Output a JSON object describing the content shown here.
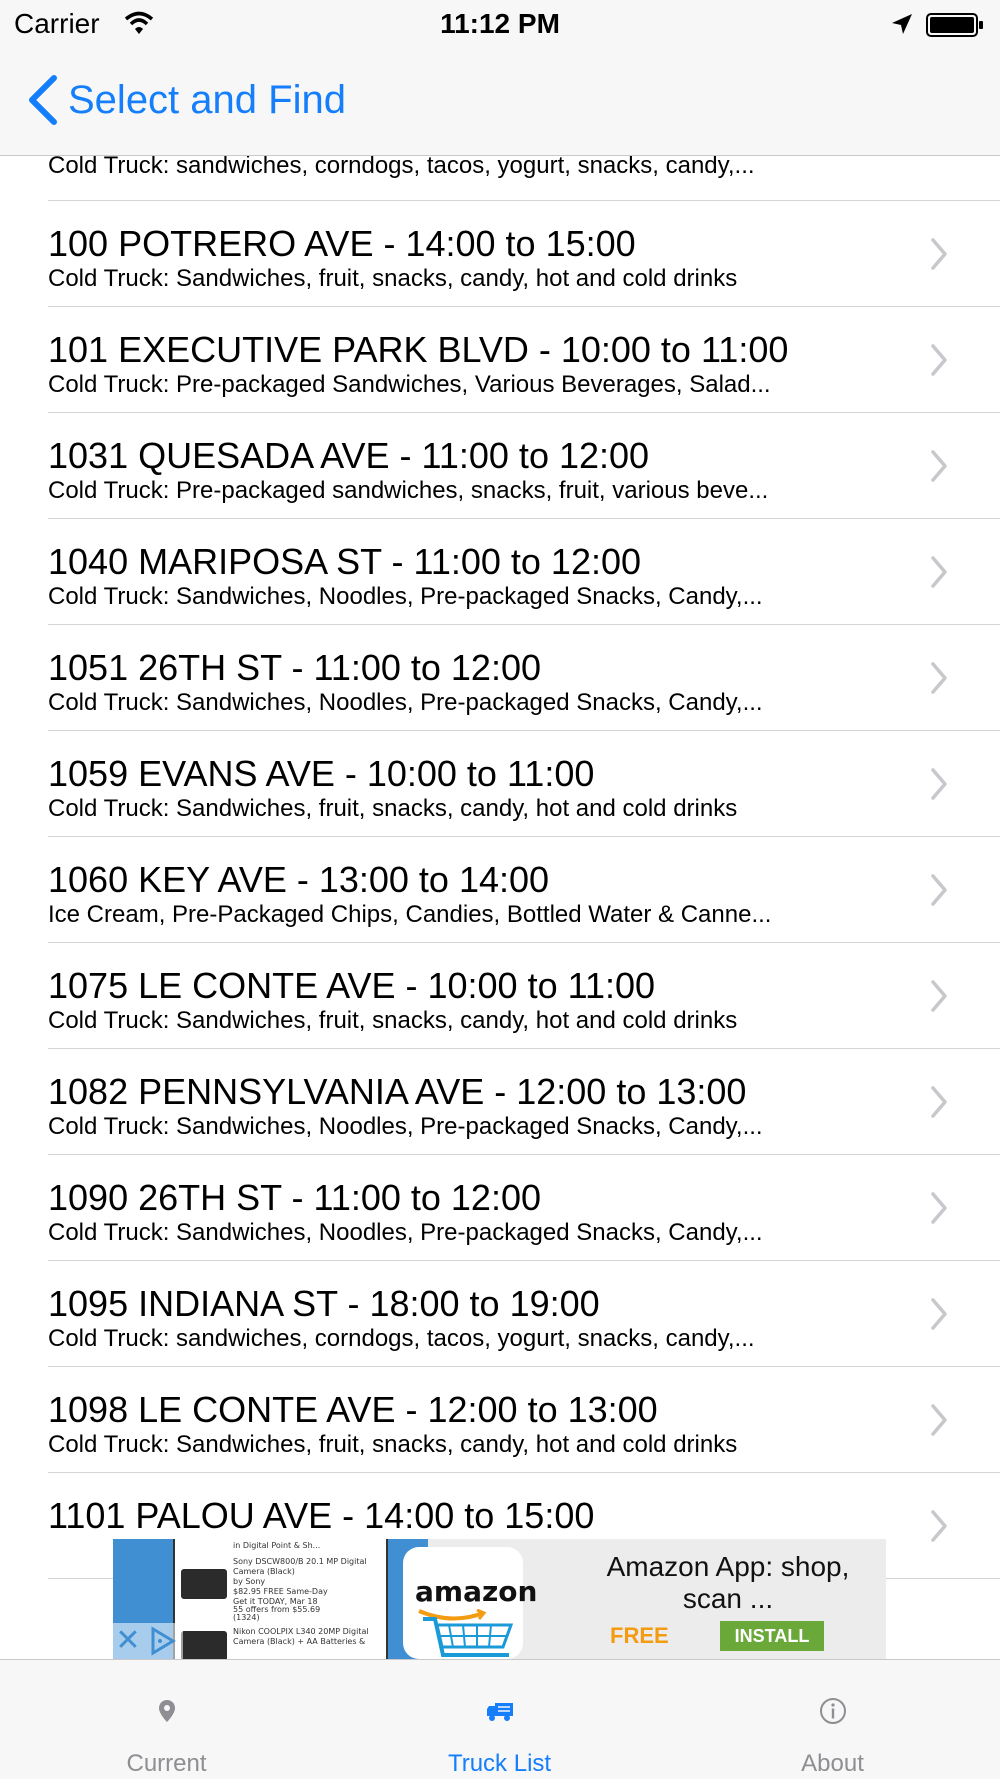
{
  "status_bar": {
    "carrier": "Carrier",
    "time": "11:12 PM",
    "icons": [
      "wifi-icon",
      "location-arrow-icon",
      "battery-icon"
    ]
  },
  "nav": {
    "back_label": "Select and Find",
    "back_icon": "chevron-left-icon"
  },
  "list": {
    "partial_top_subtitle": "Cold Truck: sandwiches, corndogs, tacos, yogurt, snacks, candy,...",
    "items": [
      {
        "title": "100 POTRERO AVE - 14:00 to 15:00",
        "subtitle": "Cold Truck: Sandwiches, fruit, snacks, candy, hot and cold drinks"
      },
      {
        "title": "101 EXECUTIVE PARK BLVD - 10:00 to 11:00",
        "subtitle": "Cold Truck: Pre-packaged Sandwiches, Various Beverages, Salad..."
      },
      {
        "title": "1031 QUESADA AVE - 11:00 to 12:00",
        "subtitle": "Cold Truck: Pre-packaged sandwiches, snacks, fruit, various beve..."
      },
      {
        "title": "1040 MARIPOSA ST - 11:00 to 12:00",
        "subtitle": "Cold Truck: Sandwiches, Noodles,  Pre-packaged Snacks, Candy,..."
      },
      {
        "title": "1051 26TH ST - 11:00 to 12:00",
        "subtitle": "Cold Truck: Sandwiches, Noodles,  Pre-packaged Snacks, Candy,..."
      },
      {
        "title": "1059 EVANS AVE - 10:00 to 11:00",
        "subtitle": "Cold Truck: Sandwiches, fruit, snacks, candy, hot and cold drinks"
      },
      {
        "title": "1060 KEY AVE - 13:00 to 14:00",
        "subtitle": "Ice Cream, Pre-Packaged Chips, Candies, Bottled Water & Canne..."
      },
      {
        "title": "1075 LE CONTE AVE - 10:00 to 11:00",
        "subtitle": "Cold Truck: Sandwiches, fruit, snacks, candy, hot and cold drinks"
      },
      {
        "title": "1082 PENNSYLVANIA AVE - 12:00 to 13:00",
        "subtitle": "Cold Truck: Sandwiches, Noodles,  Pre-packaged Snacks, Candy,..."
      },
      {
        "title": "1090 26TH ST - 11:00 to 12:00",
        "subtitle": "Cold Truck: Sandwiches, Noodles,  Pre-packaged Snacks, Candy,..."
      },
      {
        "title": "1095 INDIANA ST - 18:00 to 19:00",
        "subtitle": "Cold Truck: sandwiches, corndogs, tacos, yogurt, snacks, candy,..."
      },
      {
        "title": "1098 LE CONTE AVE - 12:00 to 13:00",
        "subtitle": "Cold Truck: Sandwiches, fruit, snacks, candy, hot and cold drinks"
      },
      {
        "title": "1101 PALOU AVE - 14:00 to 15:00",
        "subtitle": ""
      }
    ]
  },
  "ad": {
    "title": "Amazon App: shop, scan ...",
    "price": "FREE",
    "install_label": "INSTALL",
    "logo_text": "amazon",
    "screenshot_lines": [
      "in Digital Point & Sh...",
      "Sony DSCW800/B 20.1 MP Digital",
      "Camera (Black)",
      "by Sony",
      "$82.95 FREE Same-Day",
      "Get it TODAY, Mar 18",
      "55 offers from $55.69",
      "(1324)",
      "Nikon COOLPIX L340 20MP Digital",
      "Camera (Black) + AA Batteries &"
    ],
    "close_glyph": "✕"
  },
  "tabs": [
    {
      "label": "Current",
      "icon": "map-pin-icon",
      "active": false
    },
    {
      "label": "Truck List",
      "icon": "truck-icon",
      "active": true
    },
    {
      "label": "About",
      "icon": "info-icon",
      "active": false
    }
  ],
  "colors": {
    "accent": "#147efb",
    "inactive_tab": "#8e8e93",
    "bar_background": "#f7f7f7",
    "separator": "#d4d4d8"
  }
}
